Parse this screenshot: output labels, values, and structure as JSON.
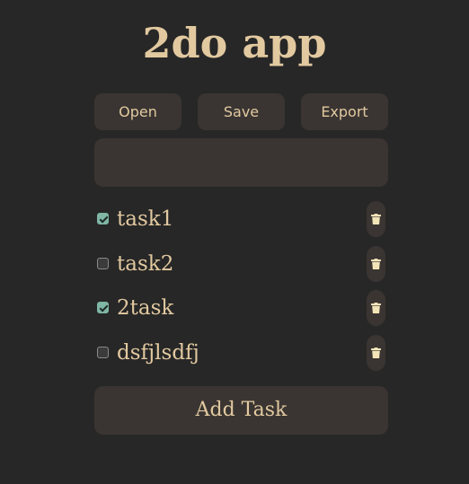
{
  "app": {
    "title": "2do app"
  },
  "toolbar": {
    "open_label": "Open",
    "save_label": "Save",
    "export_label": "Export"
  },
  "task_input": {
    "value": "",
    "placeholder": ""
  },
  "tasks": [
    {
      "label": "task1",
      "checked": true
    },
    {
      "label": "task2",
      "checked": false
    },
    {
      "label": "2task",
      "checked": true
    },
    {
      "label": "dsfjlsdfj",
      "checked": false
    }
  ],
  "add_button": {
    "label": "Add Task"
  },
  "colors": {
    "background": "#272727",
    "surface": "#3a3532",
    "text": "#e2c9a0",
    "checkbox_accent": "#7fb6a5"
  },
  "icons": {
    "delete": "trash-icon"
  }
}
